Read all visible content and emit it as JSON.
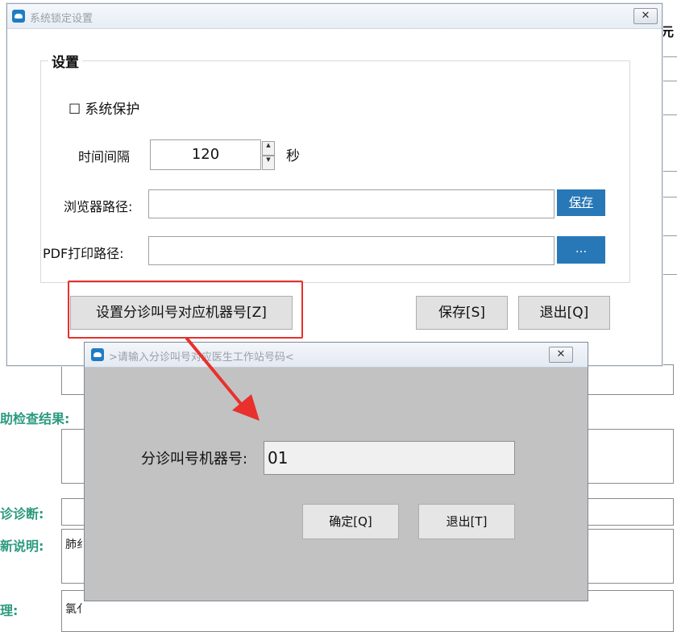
{
  "background_app": {
    "right_partial_char": "元",
    "labels": {
      "exam_result": "助检查结果:",
      "diagnosis": "诊诊断:",
      "note": "新说明:",
      "reason": "理:"
    },
    "values": {
      "note_text": "肺纟",
      "reason_text": "氯亻"
    }
  },
  "main_dialog": {
    "title": "系统锁定设置",
    "close_label": "✕",
    "group_title": "设置",
    "protect_checkbox": {
      "symbol": "☐",
      "label": "系统保护"
    },
    "interval_label": "时间间隔",
    "interval_value": "120",
    "interval_unit": "秒",
    "browser_path_label": "浏览器路径:",
    "browser_path_value": "",
    "browser_save_btn": "保存",
    "pdf_path_label": "PDF打印路径:",
    "pdf_path_value": "",
    "pdf_browse_btn": "...",
    "set_machine_btn": "设置分诊叫号对应机器号[Z]",
    "save_btn": "保存[S]",
    "exit_btn": "退出[Q]"
  },
  "sub_dialog": {
    "title": ">请输入分诊叫号对应医生工作站号码<",
    "close_label": "✕",
    "machine_label": "分诊叫号机器号:",
    "machine_value": "01",
    "confirm_btn": "确定[Q]",
    "exit_btn": "退出[T]"
  },
  "colors": {
    "accent_blue": "#2878b8",
    "highlight_red": "#e8302c",
    "bg_label_green": "#2c9a7e",
    "sub_dialog_bg": "#c2c2c2"
  }
}
